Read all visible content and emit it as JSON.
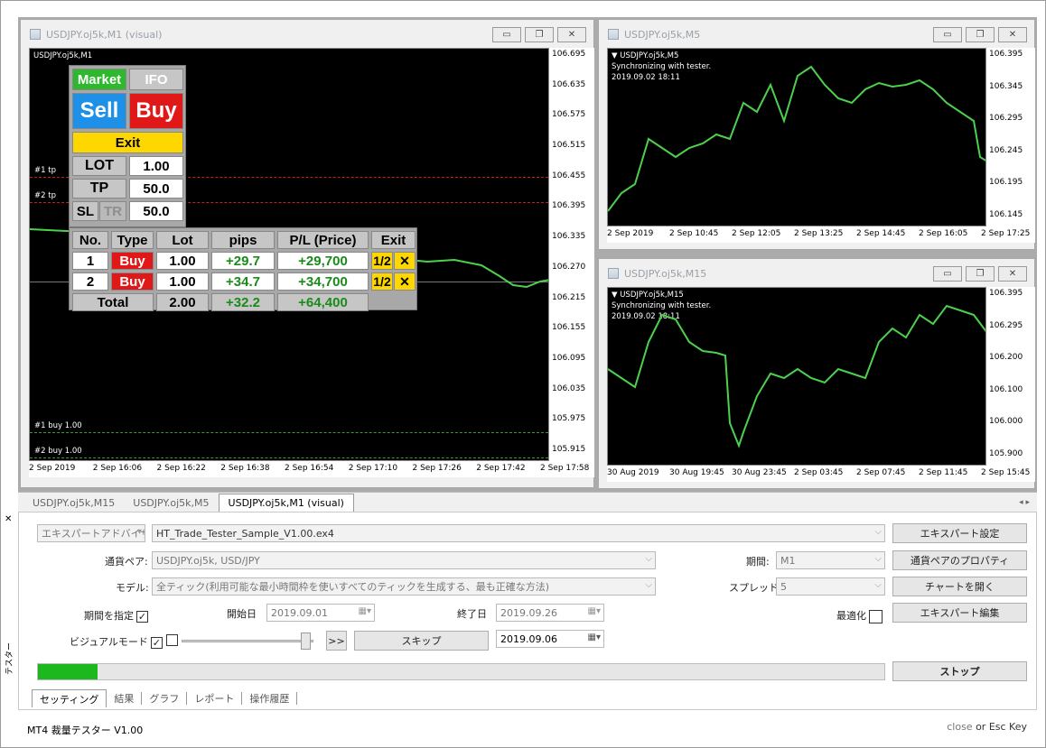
{
  "windows": {
    "m1": {
      "title": "USDJPY.oj5k,M1 (visual)",
      "symbol_label": "USDJPY.oj5k,M1",
      "price_labels": [
        "106.695",
        "106.635",
        "106.575",
        "106.515",
        "106.455",
        "106.395",
        "106.335",
        "106.270",
        "106.215",
        "106.155",
        "106.095",
        "106.035",
        "105.975",
        "105.915"
      ],
      "time_labels": [
        "2 Sep 2019",
        "2 Sep 16:06",
        "2 Sep 16:22",
        "2 Sep 16:38",
        "2 Sep 16:54",
        "2 Sep 17:10",
        "2 Sep 17:26",
        "2 Sep 17:42",
        "2 Sep 17:58"
      ],
      "line_labels": {
        "tp1": "#1 tp",
        "tp2": "#2 tp",
        "buy1": "#1 buy 1.00",
        "buy2": "#2 buy 1.00"
      }
    },
    "m5": {
      "title": "USDJPY.oj5k,M5",
      "symbol_label": "▼ USDJPY.oj5k,M5",
      "sync": "Synchronizing with tester.",
      "datetime": "2019.09.02 18:11",
      "price_labels": [
        "106.395",
        "106.345",
        "106.295",
        "106.245",
        "106.195",
        "106.145"
      ],
      "time_labels": [
        "2 Sep 2019",
        "2 Sep 10:45",
        "2 Sep 12:05",
        "2 Sep 13:25",
        "2 Sep 14:45",
        "2 Sep 16:05",
        "2 Sep 17:25"
      ]
    },
    "m15": {
      "title": "USDJPY.oj5k,M15",
      "symbol_label": "▼ USDJPY.oj5k,M15",
      "sync": "Synchronizing with tester.",
      "datetime": "2019.09.02 18:11",
      "price_labels": [
        "106.395",
        "106.295",
        "106.200",
        "106.100",
        "106.000",
        "105.900"
      ],
      "time_labels": [
        "30 Aug 2019",
        "30 Aug 19:45",
        "30 Aug 23:45",
        "2 Sep 03:45",
        "2 Sep 07:45",
        "2 Sep 11:45",
        "2 Sep 15:45"
      ]
    }
  },
  "panel": {
    "market": "Market",
    "ifo": "IFO",
    "sell": "Sell",
    "buy": "Buy",
    "exit": "Exit",
    "lot_label": "LOT",
    "lot_value": "1.00",
    "tp_label": "TP",
    "tp_value": "50.0",
    "sl_label": "SL",
    "tr_label": "TR",
    "sl_value": "50.0",
    "headers": [
      "No.",
      "Type",
      "Lot",
      "pips",
      "P/L (Price)",
      "Exit"
    ],
    "rows": [
      {
        "no": "1",
        "type": "Buy",
        "lot": "1.00",
        "pips": "+29.7",
        "pl": "+29,700",
        "half": "1/2",
        "close": "✕"
      },
      {
        "no": "2",
        "type": "Buy",
        "lot": "1.00",
        "pips": "+34.7",
        "pl": "+34,700",
        "half": "1/2",
        "close": "✕"
      }
    ],
    "total": {
      "label": "Total",
      "lot": "2.00",
      "pips": "+32.2",
      "pl": "+64,400"
    }
  },
  "tabs": [
    "USDJPY.oj5k,M15",
    "USDJPY.oj5k,M5",
    "USDJPY.oj5k,M1 (visual)"
  ],
  "tester": {
    "side_label": "テスター",
    "expert_type": "エキスパートアドバイザ",
    "expert_file": "HT_Trade_Tester_Sample_V1.00.ex4",
    "pair_label": "通貨ペア:",
    "pair_value": "USDJPY.oj5k, USD/JPY",
    "model_label": "モデル:",
    "model_value": "全ティック(利用可能な最小時間枠を使いすべてのティックを生成する、最も正確な方法)",
    "period_label": "期間:",
    "period_value": "M1",
    "spread_label": "スプレッド:",
    "spread_value": "5",
    "use_date_label": "期間を指定",
    "start_label": "開始日",
    "start_value": "2019.09.01",
    "end_label": "終了日",
    "end_value": "2019.09.26",
    "optimize_label": "最適化",
    "visual_label": "ビジュアルモード",
    "ff_label": ">>",
    "skip_label": "スキップ",
    "skip_date": "2019.09.06",
    "buttons": {
      "expert_settings": "エキスパート設定",
      "pair_props": "通貨ペアのプロパティ",
      "open_chart": "チャートを開く",
      "edit_expert": "エキスパート編集",
      "stop": "ストップ"
    },
    "bottom_tabs": [
      "セッティング",
      "結果",
      "グラフ",
      "レポート",
      "操作履歴"
    ],
    "progress": 0.07,
    "progress_color": "#1db81d"
  },
  "footer": {
    "left": "MT4 裁量テスター V1.00",
    "close": "close",
    "or": " or ",
    "esc": "Esc Key"
  },
  "colors": {
    "candle": "#4cd14c",
    "tp_line": "#c82020",
    "buy_line": "#3a9a3a",
    "sell_btn": "#1e90e8",
    "buy_btn": "#e01818",
    "exit_btn": "#ffd700"
  }
}
